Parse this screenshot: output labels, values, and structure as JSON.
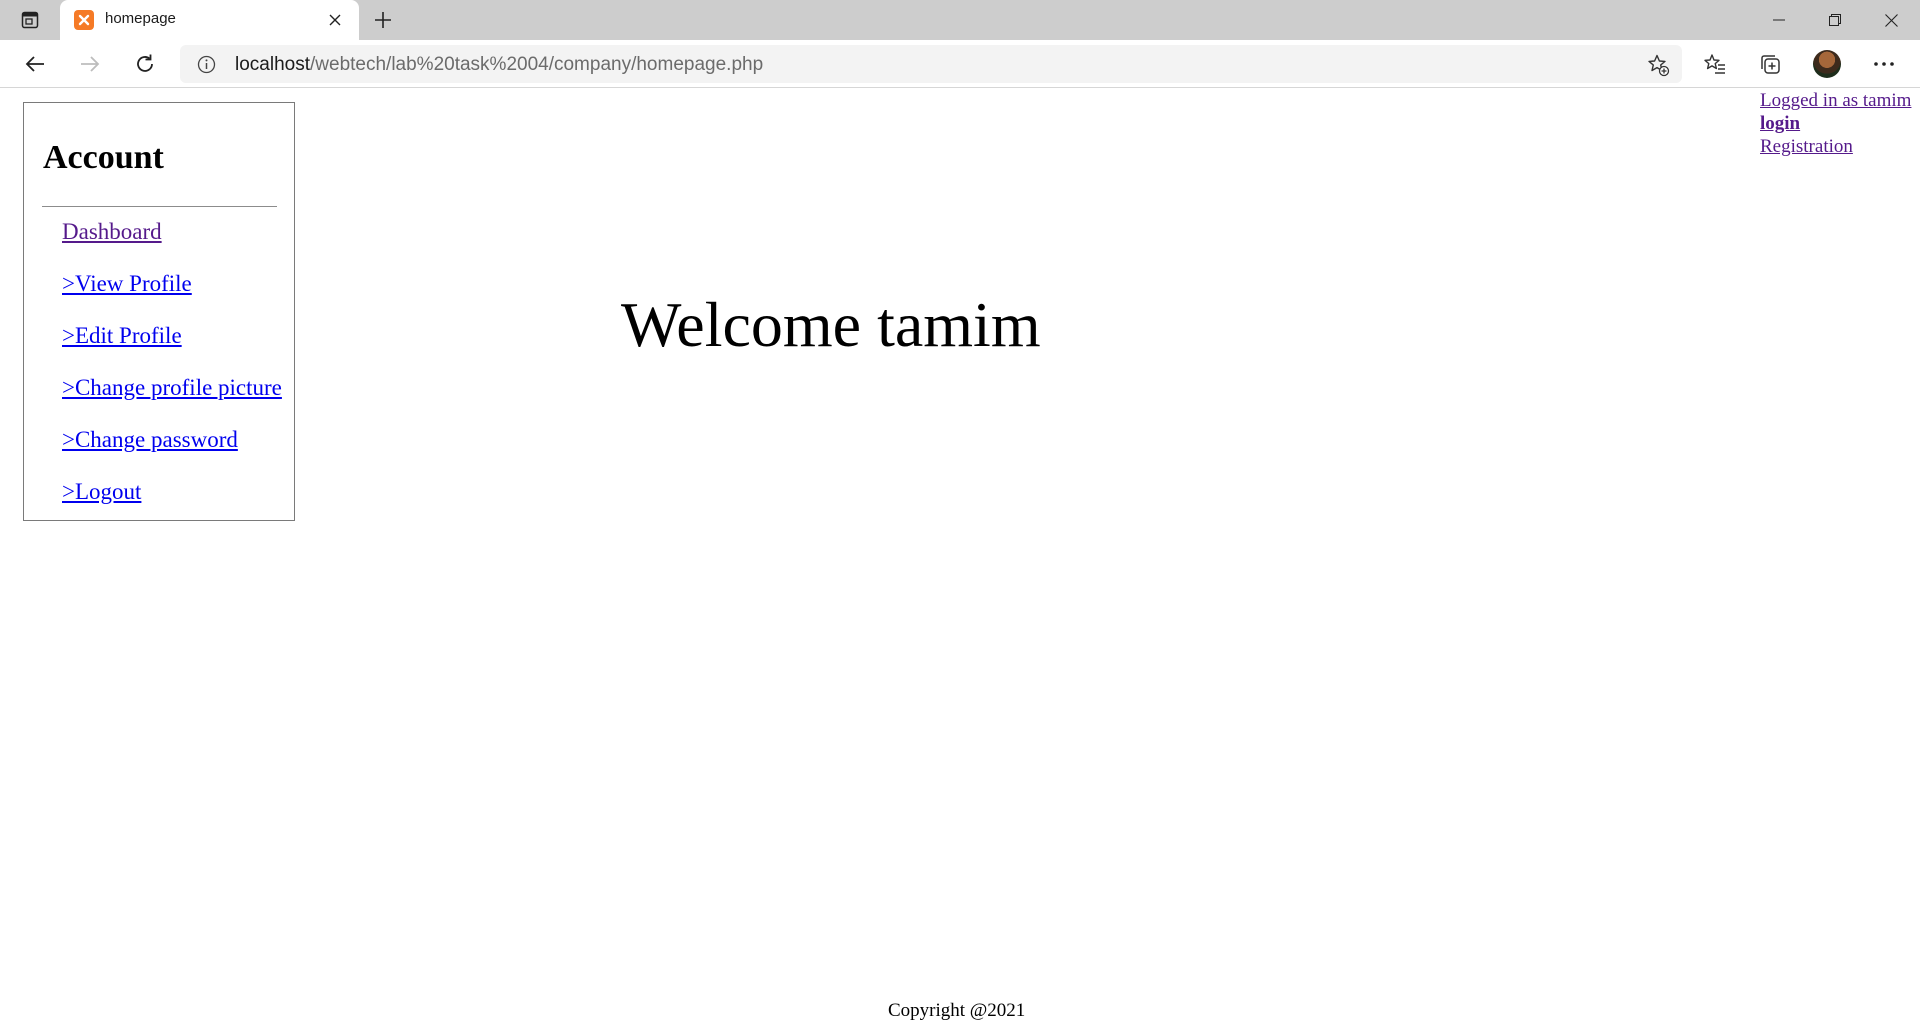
{
  "browser": {
    "tab_title": "homepage",
    "url_host": "localhost",
    "url_path": "/webtech/lab%20task%2004/company/homepage.php"
  },
  "sidebar": {
    "title": "Account",
    "items": [
      {
        "label": "Dashboard",
        "visited": true
      },
      {
        "label": ">View Profile",
        "visited": false
      },
      {
        "label": ">Edit Profile",
        "visited": false
      },
      {
        "label": ">Change profile picture",
        "visited": false
      },
      {
        "label": ">Change password",
        "visited": false
      },
      {
        "label": ">Logout",
        "visited": false
      }
    ]
  },
  "main": {
    "welcome": "Welcome tamim"
  },
  "header_links": {
    "logged_in": "Logged in as tamim",
    "login": "login",
    "registration": "Registration"
  },
  "footer": {
    "copyright": "Copyright @2021"
  },
  "colors": {
    "link": "#0000ee",
    "visited_link": "#551a8b",
    "tabbar": "#cdcdcd",
    "favicon": "#f57a26"
  }
}
